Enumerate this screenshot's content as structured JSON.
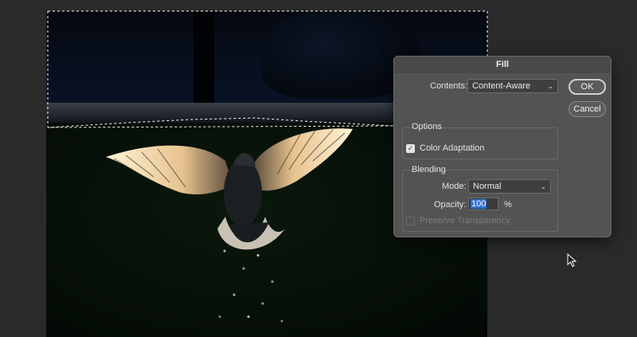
{
  "dialog": {
    "title": "Fill",
    "contents_label": "Contents:",
    "contents_value": "Content-Aware",
    "ok_label": "OK",
    "cancel_label": "Cancel",
    "options": {
      "title": "Options",
      "color_adaptation_label": "Color Adaptation",
      "color_adaptation_checked": true
    },
    "blending": {
      "title": "Blending",
      "mode_label": "Mode:",
      "mode_value": "Normal",
      "opacity_label": "Opacity:",
      "opacity_value": "100",
      "opacity_unit": "%",
      "preserve_transparency_label": "Preserve Transparency",
      "preserve_transparency_checked": false
    }
  },
  "icons": {
    "checkmark": "✓",
    "chevron": "⌄"
  },
  "colors": {
    "dialog_bg": "#535353",
    "highlight": "#2f6fd6"
  }
}
